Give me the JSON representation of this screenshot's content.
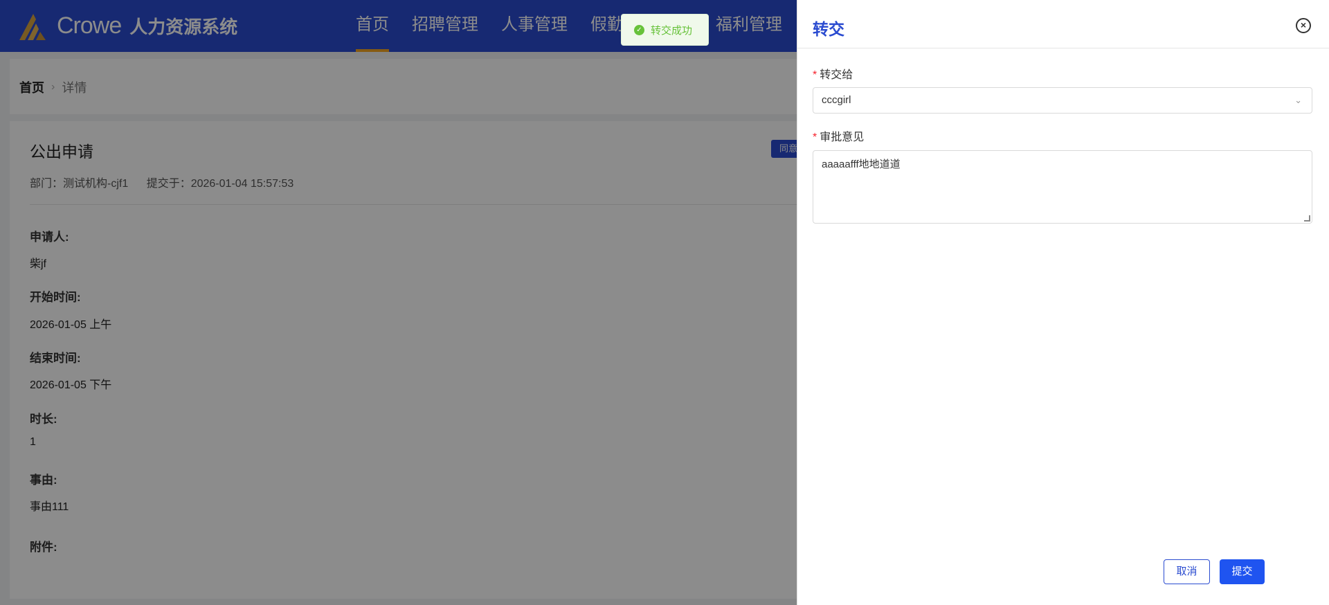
{
  "header": {
    "brand": "Crowe",
    "system_name": "人力资源系统",
    "nav": [
      {
        "label": "首页"
      },
      {
        "label": "招聘管理"
      },
      {
        "label": "人事管理"
      },
      {
        "label": "假勤"
      },
      {
        "label": "福利管理"
      }
    ]
  },
  "breadcrumb": {
    "home": "首页",
    "current": "详情"
  },
  "detail": {
    "title": "公出申请",
    "department": "部门：测试机构-cjf1",
    "submitted": "提交于：2026-01-04 15:57:53",
    "agree_label": "同意",
    "fields": [
      {
        "label": "申请人:",
        "value": "柴jf"
      },
      {
        "label": "开始时间:",
        "value": "2026-01-05 上午"
      },
      {
        "label": "结束时间:",
        "value": "2026-01-05 下午"
      },
      {
        "label": "时长:",
        "value": "1"
      },
      {
        "label": "事由:",
        "value": "事由111"
      },
      {
        "label": "附件:",
        "value": ""
      }
    ]
  },
  "drawer": {
    "title": "转交",
    "transfer_label": "转交给",
    "transfer_value": "cccgirl",
    "opinion_label": "审批意见",
    "opinion_value": "aaaaafff地地道道",
    "cancel_label": "取消",
    "submit_label": "提交"
  },
  "toast": {
    "text": "转交成功"
  },
  "colors": {
    "primary": "#2a4bd0",
    "accent": "#f5a623",
    "success": "#67c23a",
    "required": "#f5222d"
  },
  "icons": {
    "close": "close-circle-icon",
    "toast": "check-circle-icon",
    "select_arrow": "chevron-down-icon",
    "breadcrumb_sep": "chevron-right-icon"
  }
}
